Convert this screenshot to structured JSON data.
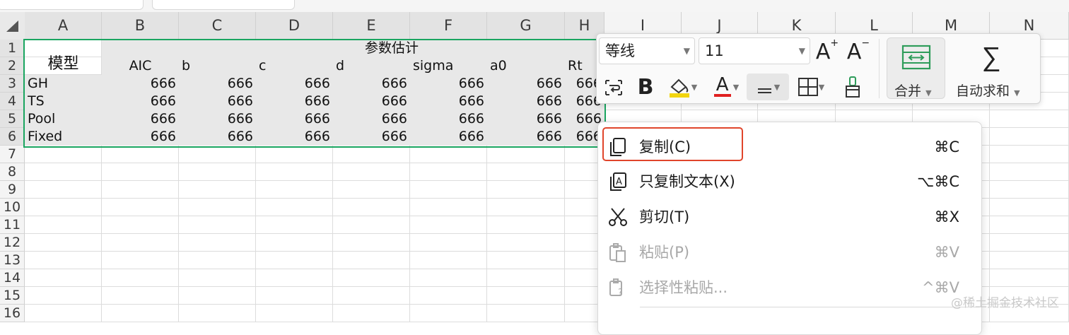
{
  "columns": [
    "A",
    "B",
    "C",
    "D",
    "E",
    "F",
    "G",
    "H",
    "I",
    "J",
    "K",
    "L",
    "M",
    "N"
  ],
  "rows": [
    "1",
    "2",
    "3",
    "4",
    "5",
    "6",
    "7",
    "8",
    "9",
    "10",
    "11",
    "12",
    "13",
    "14",
    "15",
    "16"
  ],
  "sheet": {
    "merged_header": "参数估计",
    "model_header": "模型",
    "aic_header": "AIC",
    "param_headers": [
      "b",
      "c",
      "d",
      "sigma",
      "a0",
      "Rt"
    ],
    "data_rows": [
      {
        "label": "GH",
        "values": [
          "666",
          "666",
          "666",
          "666",
          "666",
          "666",
          "666"
        ]
      },
      {
        "label": "TS",
        "values": [
          "666",
          "666",
          "666",
          "666",
          "666",
          "666",
          "666"
        ]
      },
      {
        "label": "Pool",
        "values": [
          "666",
          "666",
          "666",
          "666",
          "666",
          "666",
          "666"
        ]
      },
      {
        "label": "Fixed",
        "values": [
          "666",
          "666",
          "666",
          "666",
          "666",
          "666",
          "666"
        ]
      }
    ],
    "selection_color": "#1aa560"
  },
  "toolbar": {
    "font_name": "等线",
    "font_size": "11",
    "increase_font": "A",
    "decrease_font": "A",
    "bold": "B",
    "font_color_letter": "A",
    "merge_label": "合并",
    "autosum_label": "自动求和",
    "autosum_symbol": "∑",
    "font_color": "#e02020",
    "fill_color": "#f2d50f",
    "merge_icon_color": "#2e9c5a"
  },
  "context_menu": {
    "items": [
      {
        "label": "复制(C)",
        "shortcut": "⌘C",
        "enabled": true,
        "icon": "copy-icon"
      },
      {
        "label": "只复制文本(X)",
        "shortcut": "⌥⌘C",
        "enabled": true,
        "icon": "copy-text-icon"
      },
      {
        "label": "剪切(T)",
        "shortcut": "⌘X",
        "enabled": true,
        "icon": "scissors-icon"
      },
      {
        "label": "粘贴(P)",
        "shortcut": "⌘V",
        "enabled": false,
        "icon": "paste-icon"
      },
      {
        "label": "选择性粘贴...",
        "shortcut": "^⌘V",
        "enabled": false,
        "icon": "paste-special-icon"
      }
    ],
    "highlight_color": "#e0452b"
  },
  "watermark": "@稀土掘金技术社区"
}
